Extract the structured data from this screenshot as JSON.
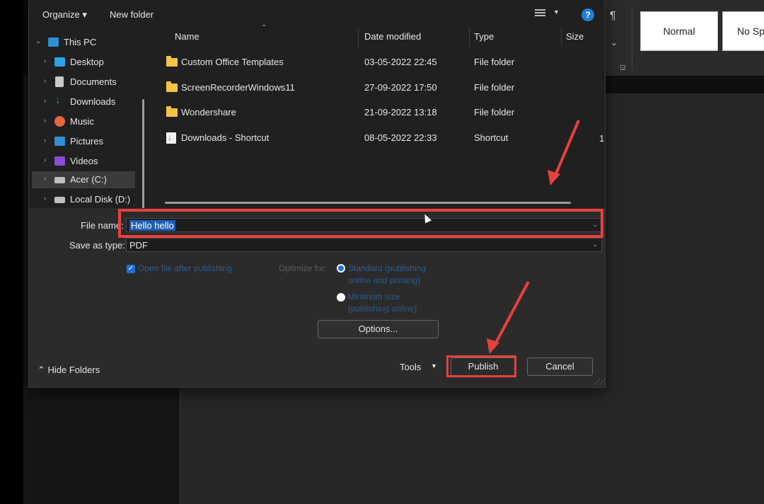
{
  "ribbon": {
    "styles": [
      "Normal",
      "No Spa"
    ],
    "pilcrow": "¶"
  },
  "dialog": {
    "toolbar": {
      "organize": "Organize",
      "new_folder": "New folder",
      "help": "?"
    },
    "nav": {
      "items": [
        {
          "label": "This PC",
          "icon": "pc-icon",
          "color": "#2f8fd6",
          "expanded": true
        },
        {
          "label": "Desktop",
          "icon": "desktop-icon",
          "color": "#2aa3e8"
        },
        {
          "label": "Documents",
          "icon": "documents-icon",
          "color": "#c9c9c9"
        },
        {
          "label": "Downloads",
          "icon": "downloads-icon",
          "color": "#1aa35d"
        },
        {
          "label": "Music",
          "icon": "music-icon",
          "color": "#e8673a"
        },
        {
          "label": "Pictures",
          "icon": "pictures-icon",
          "color": "#2f8fd6"
        },
        {
          "label": "Videos",
          "icon": "videos-icon",
          "color": "#8a4cd6"
        },
        {
          "label": "Acer (C:)",
          "icon": "drive-icon",
          "color": "#bdbdbd",
          "selected": true
        },
        {
          "label": "Local Disk (D:)",
          "icon": "drive-icon",
          "color": "#bdbdbd"
        }
      ]
    },
    "columns": [
      "Name",
      "Date modified",
      "Type",
      "Size"
    ],
    "files": [
      {
        "name": "Custom Office Templates",
        "date": "03-05-2022 22:45",
        "type": "File folder",
        "icon": "folder-icon"
      },
      {
        "name": "ScreenRecorderWindows11",
        "date": "27-09-2022 17:50",
        "type": "File folder",
        "icon": "folder-icon"
      },
      {
        "name": "Wondershare",
        "date": "21-09-2022 13:18",
        "type": "File folder",
        "icon": "folder-icon"
      },
      {
        "name": "Downloads - Shortcut",
        "date": "08-05-2022 22:33",
        "type": "Shortcut",
        "icon": "shortcut-icon"
      }
    ],
    "size_edge": "1",
    "file_name_label": "File name:",
    "file_name_value": "Hello hello",
    "save_type_label": "Save as type:",
    "save_type_value": "PDF",
    "open_after": "Open file after publishing",
    "optimize_label": "Optimize for:",
    "optimize_standard": [
      "Standard (publishing",
      "online and printing)"
    ],
    "optimize_minimum": [
      "Minimum size",
      "(publishing online)"
    ],
    "options_button": "Options...",
    "hide_folders": "Hide Folders",
    "tools": "Tools",
    "publish": "Publish",
    "cancel": "Cancel"
  },
  "annotation_color": "#e8403f"
}
